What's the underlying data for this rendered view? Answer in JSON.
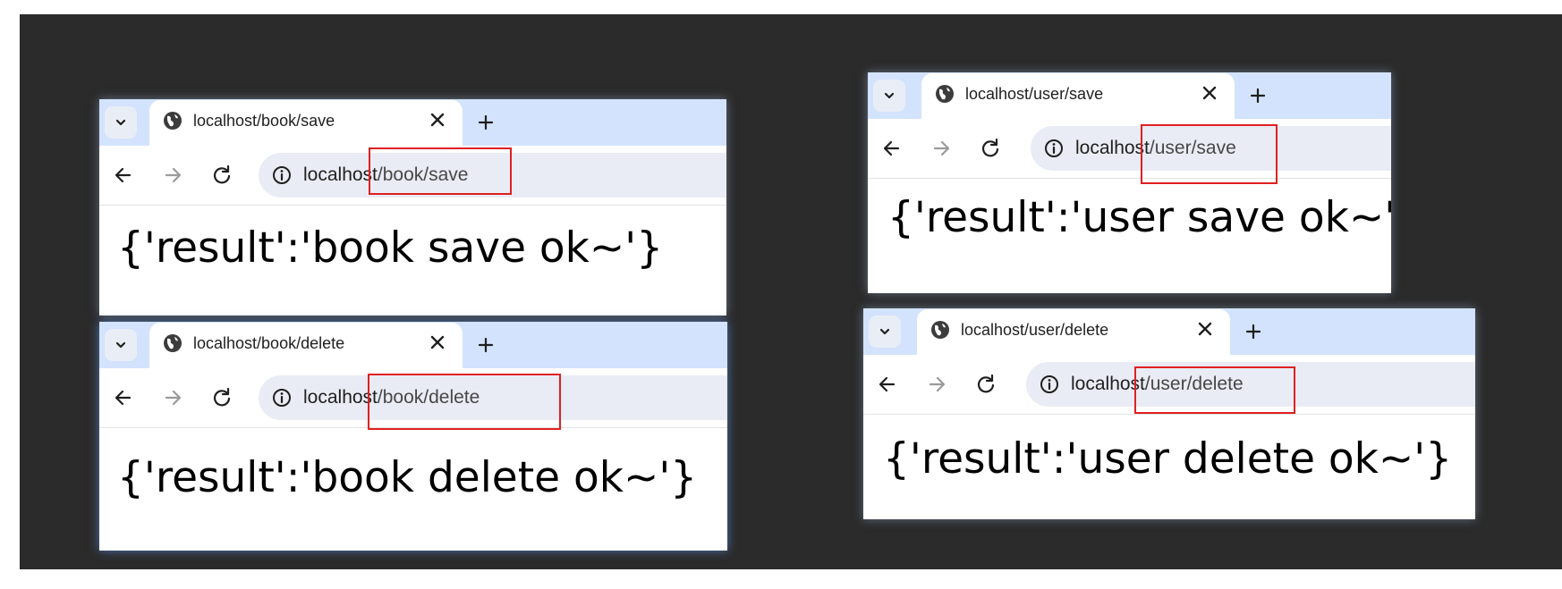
{
  "colors": {
    "tabbar": "#d3e3fd",
    "omnibox": "#e9ecf4",
    "highlight": "#e02020",
    "backdrop": "#2b2b2b"
  },
  "icons": {
    "dropdown": "chevron-down-icon",
    "tab": "globe-icon",
    "close": "close-icon",
    "new_tab": "plus-icon",
    "back": "arrow-left-icon",
    "forward": "arrow-right-icon",
    "reload": "reload-icon",
    "site_info": "info-icon"
  },
  "windows": [
    {
      "tab_title": "localhost/book/save",
      "url_host": "localhost",
      "url_path": "/book/save",
      "body": "{'result':'book save ok~'}"
    },
    {
      "tab_title": "localhost/book/delete",
      "url_host": "localhost",
      "url_path": "/book/delete",
      "body": "{'result':'book delete ok~'}"
    },
    {
      "tab_title": "localhost/user/save",
      "url_host": "localhost",
      "url_path": "/user/save",
      "body": "{'result':'user save ok~'}"
    },
    {
      "tab_title": "localhost/user/delete",
      "url_host": "localhost",
      "url_path": "/user/delete",
      "body": "{'result':'user delete ok~'}"
    }
  ]
}
